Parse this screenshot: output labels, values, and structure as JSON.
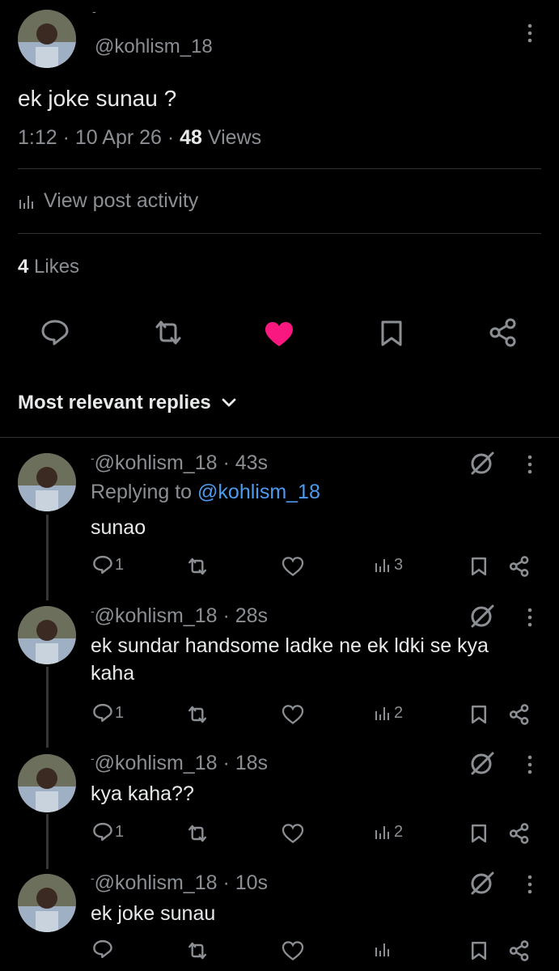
{
  "colors": {
    "background": "#000000",
    "text": "#e7e9ea",
    "muted": "#8b8f94",
    "link": "#4d9bef",
    "like_active": "#f91880",
    "divider": "#2f3336"
  },
  "post": {
    "top_mark": "-",
    "handle": "@kohlism_18",
    "text": "ek joke sunau ?",
    "time": "1:12",
    "date": "10 Apr 26",
    "views_count": "48",
    "views_label": "Views",
    "activity_label": "View post activity",
    "likes_count": "4",
    "likes_label": "Likes",
    "liked": true
  },
  "sort": {
    "label": "Most relevant replies"
  },
  "replies": [
    {
      "handle": "@kohlism_18",
      "time": "43s",
      "replying_prefix": "Replying to ",
      "replying_handle": "@kohlism_18",
      "text": "sunao",
      "reply_count": "1",
      "view_count": "3"
    },
    {
      "handle": "@kohlism_18",
      "time": "28s",
      "text_line1": "ek sundar handsome ladke ne ek ldki se kya",
      "text_line2": "kaha",
      "reply_count": "1",
      "view_count": "2"
    },
    {
      "handle": "@kohlism_18",
      "time": "18s",
      "text": "kya kaha??",
      "reply_count": "1",
      "view_count": "2"
    },
    {
      "handle": "@kohlism_18",
      "time": "10s",
      "text": "ek joke sunau",
      "reply_count": "",
      "view_count": ""
    }
  ],
  "icons": [
    "more-vertical-icon",
    "analytics-icon",
    "reply-icon",
    "repost-icon",
    "heart-icon",
    "bookmark-icon",
    "share-icon",
    "grok-icon",
    "chevron-down-icon"
  ]
}
